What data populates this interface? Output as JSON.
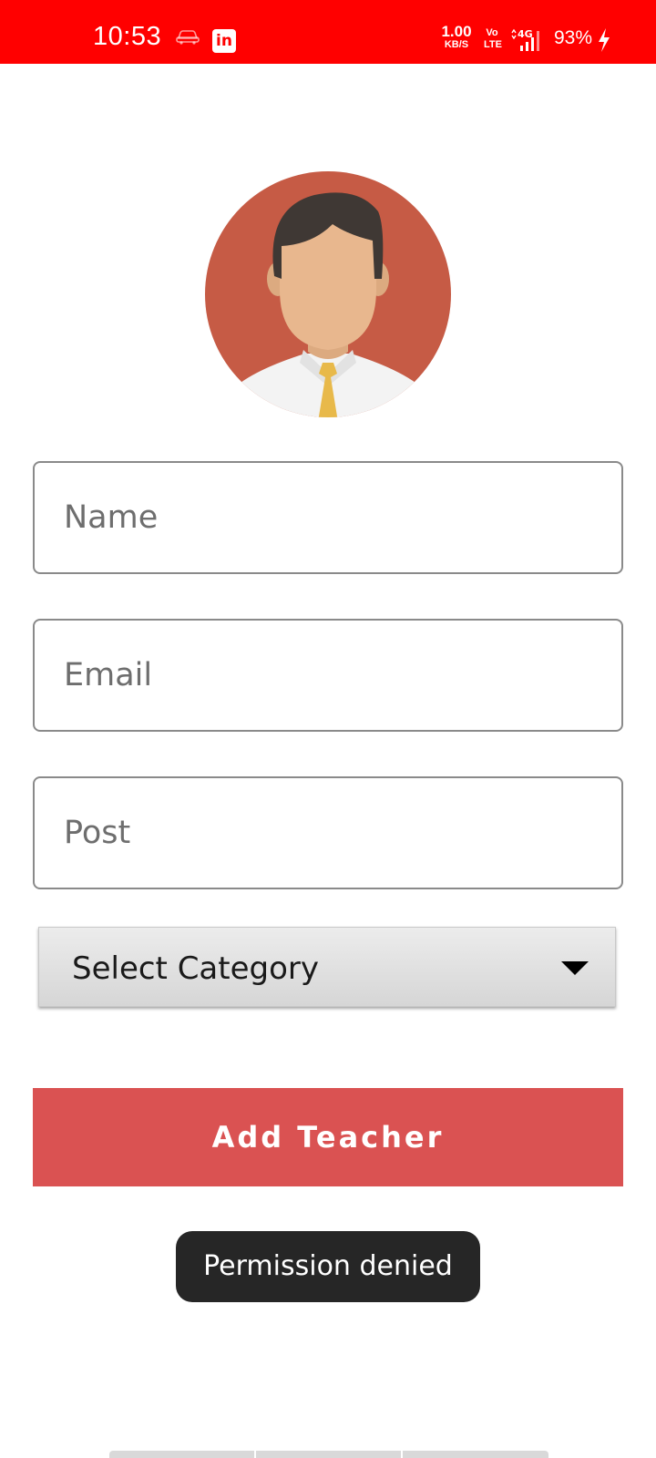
{
  "status_bar": {
    "time": "10:53",
    "net_speed_value": "1.00",
    "net_speed_unit": "KB/S",
    "volte_line1": "Vo",
    "volte_line2": "LTE",
    "network": "4G",
    "battery": "93%",
    "icons": [
      "car-icon",
      "linkedin-icon",
      "signal-icon",
      "charging-bolt-icon"
    ],
    "background_color": "#ff0000"
  },
  "avatar": {
    "icon": "teacher-avatar-icon",
    "background_color": "#c65b45"
  },
  "form": {
    "name_placeholder": "Name",
    "name_value": "",
    "email_placeholder": "Email",
    "email_value": "",
    "post_placeholder": "Post",
    "post_value": "",
    "category_selected": "Select Category",
    "add_button_label": "Add Teacher",
    "button_color": "#da5252"
  },
  "toast": {
    "message": "Permission denied"
  }
}
